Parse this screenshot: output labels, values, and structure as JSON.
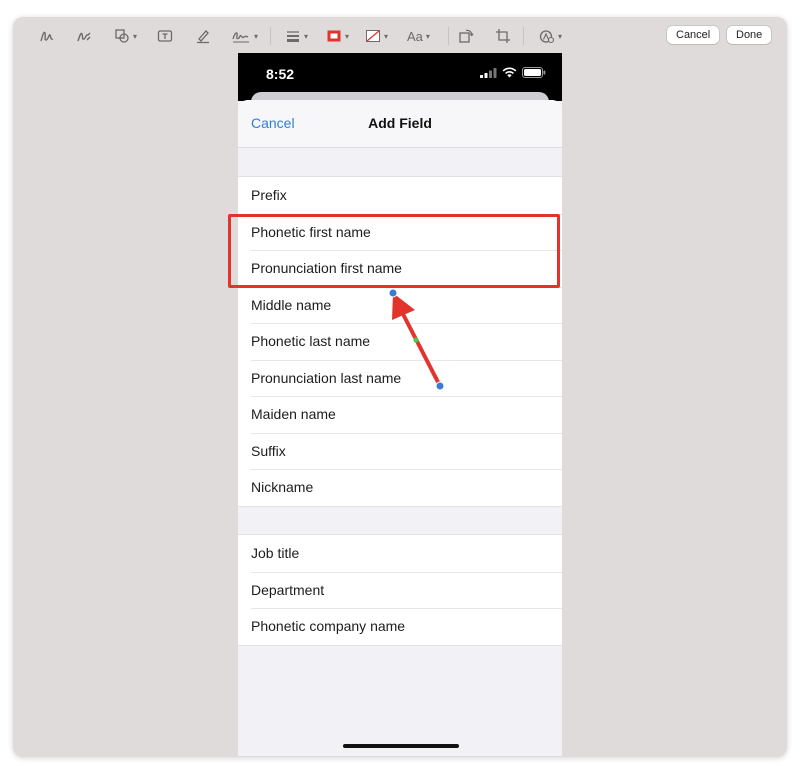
{
  "toolbar": {
    "cancel_label": "Cancel",
    "done_label": "Done",
    "text_style_label": "Aa",
    "icons": [
      "sketch-icon",
      "draw-icon",
      "shapes-icon",
      "text-box-icon",
      "highlight-icon",
      "signature-icon",
      "line-style-icon",
      "border-color-icon",
      "fill-color-icon",
      "text-style-icon",
      "rotate-icon",
      "crop-icon",
      "markup-options-icon"
    ]
  },
  "phone": {
    "status": {
      "time": "8:52"
    },
    "nav": {
      "cancel_label": "Cancel",
      "title": "Add Field"
    },
    "groups": [
      {
        "rows": [
          "Prefix",
          "Phonetic first name",
          "Pronunciation first name",
          "Middle name",
          "Phonetic last name",
          "Pronunciation last name",
          "Maiden name",
          "Suffix",
          "Nickname"
        ]
      },
      {
        "rows": [
          "Job title",
          "Department",
          "Phonetic company name"
        ]
      }
    ]
  },
  "annotations": {
    "highlight_color": "#e2342d",
    "arrow_color": "#e2342d",
    "handle_color": "#3b7bd4",
    "midpoint_handle_color": "#4cc74c",
    "highlighted_rows": [
      "Phonetic first name",
      "Pronunciation first name"
    ]
  },
  "colors": {
    "window_bg": "#dfdbdb",
    "accent": "#2f7fd5",
    "list_bg": "#f2f1f6"
  }
}
